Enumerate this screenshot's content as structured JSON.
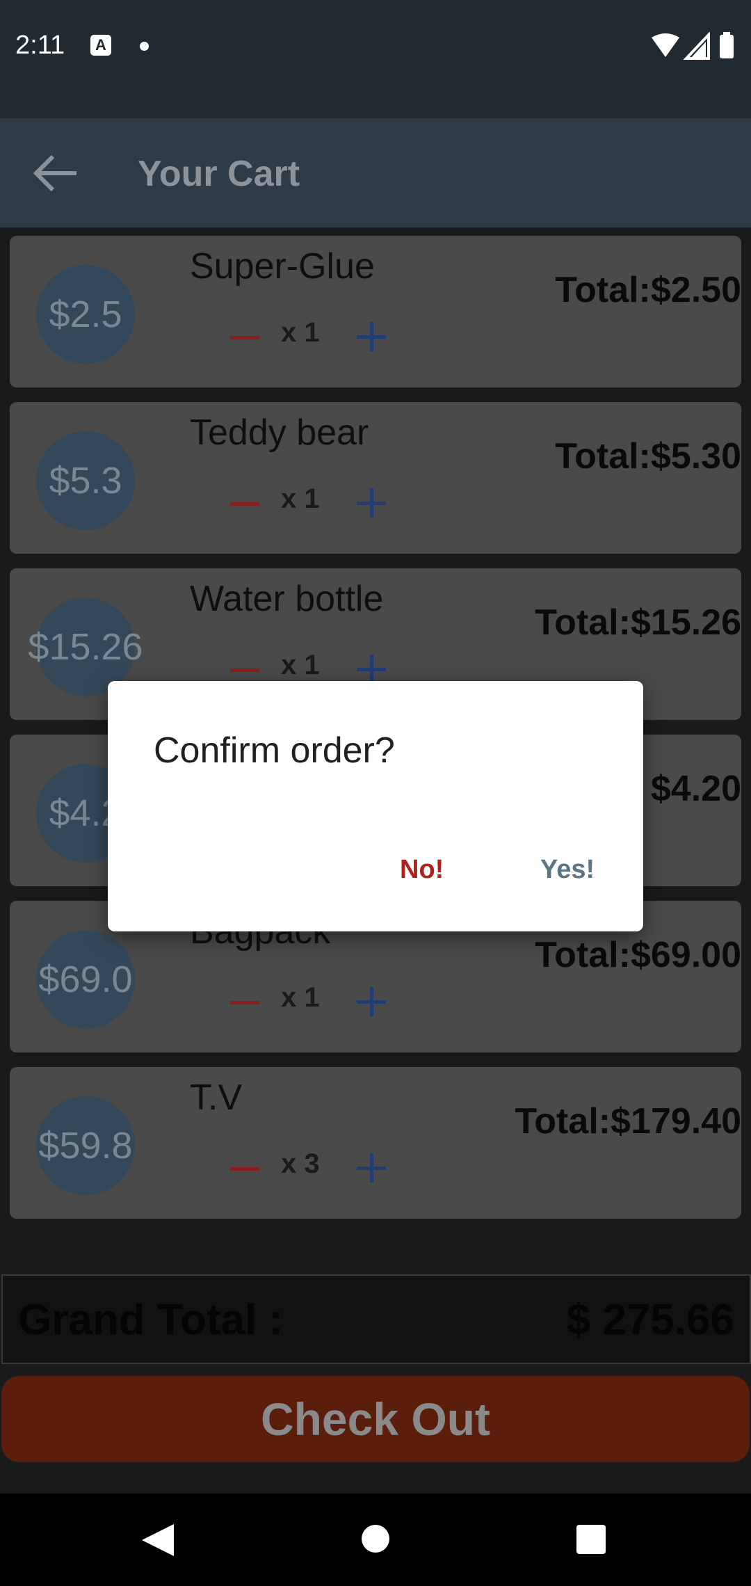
{
  "status_bar": {
    "time": "2:11",
    "notification_icon": "a-icon"
  },
  "app_bar": {
    "title": "Your Cart",
    "back_icon": "arrow-left-icon"
  },
  "cart": {
    "items": [
      {
        "price": "$2.5",
        "name": "Super-Glue",
        "qty": "x 1",
        "total": "Total:$2.50"
      },
      {
        "price": "$5.3",
        "name": "Teddy bear",
        "qty": "x 1",
        "total": "Total:$5.30"
      },
      {
        "price": "$15.26",
        "name": "Water bottle",
        "qty": "x 1",
        "total": "Total:$15.26"
      },
      {
        "price": "$4.2",
        "name": "",
        "qty": "",
        "total": "$4.20"
      },
      {
        "price": "$69.0",
        "name": "Bagpack",
        "qty": "x 1",
        "total": "Total:$69.00"
      },
      {
        "price": "$59.8",
        "name": "T.V",
        "qty": "x 3",
        "total": "Total:$179.40"
      }
    ]
  },
  "grand_total": {
    "label": "Grand Total :",
    "value": "$ 275.66"
  },
  "checkout": {
    "label": "Check Out"
  },
  "dialog": {
    "title": "Confirm order?",
    "no_label": "No!",
    "yes_label": "Yes!"
  },
  "colors": {
    "status_bar": "#222a31",
    "app_bar": "#2d3c47",
    "item_card": "#4a4a4a",
    "price_circle": "#33495a",
    "minus": "#8b1e1b",
    "plus": "#1f3d73",
    "checkout": "#5c1e0c",
    "dialog_no": "#b0211d",
    "dialog_yes": "#5a7584"
  }
}
